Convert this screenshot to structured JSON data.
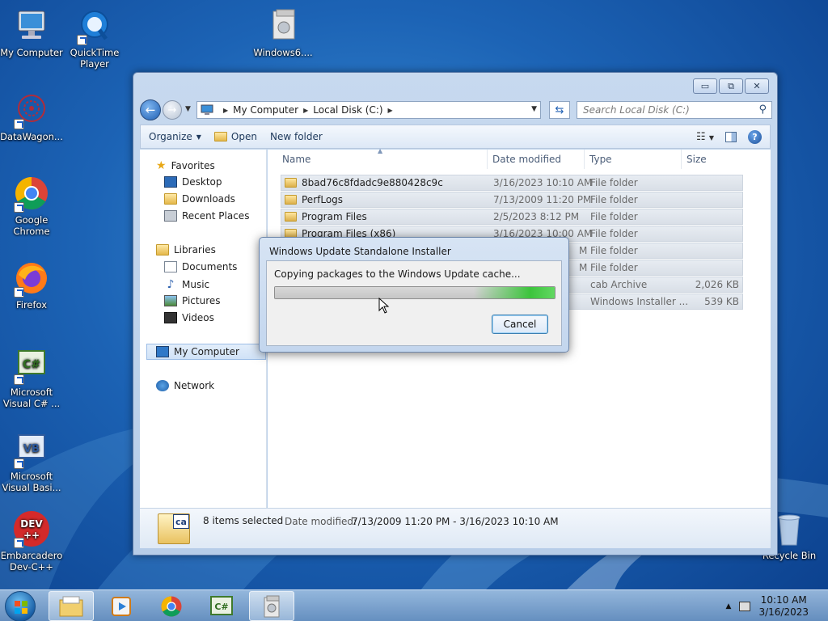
{
  "desktop": {
    "icons": [
      {
        "label": "My Computer"
      },
      {
        "label": "QuickTime Player"
      },
      {
        "label": "Windows6...."
      },
      {
        "label": "DataWagon..."
      },
      {
        "label": "Google Chrome"
      },
      {
        "label": "Firefox"
      },
      {
        "label": "Microsoft Visual C# ..."
      },
      {
        "label": "Microsoft Visual Basi..."
      },
      {
        "label": "Embarcadero Dev-C++"
      },
      {
        "label": "Recycle Bin"
      }
    ]
  },
  "explorer": {
    "breadcrumb": [
      "My Computer",
      "Local Disk (C:)"
    ],
    "search_placeholder": "Search Local Disk (C:)",
    "toolbar": {
      "organize": "Organize",
      "open": "Open",
      "new_folder": "New folder"
    },
    "nav": {
      "favorites": "Favorites",
      "desktop": "Desktop",
      "downloads": "Downloads",
      "recent": "Recent Places",
      "libraries": "Libraries",
      "documents": "Documents",
      "music": "Music",
      "pictures": "Pictures",
      "videos": "Videos",
      "my_computer": "My Computer",
      "network": "Network"
    },
    "columns": {
      "name": "Name",
      "date": "Date modified",
      "type": "Type",
      "size": "Size"
    },
    "files": [
      {
        "name": "8bad76c8fdadc9e880428c9c",
        "date": "3/16/2023 10:10 AM",
        "type": "File folder",
        "size": ""
      },
      {
        "name": "PerfLogs",
        "date": "7/13/2009 11:20 PM",
        "type": "File folder",
        "size": ""
      },
      {
        "name": "Program Files",
        "date": "2/5/2023 8:12 PM",
        "type": "File folder",
        "size": ""
      },
      {
        "name": "Program Files (x86)",
        "date": "3/16/2023 10:00 AM",
        "type": "File folder",
        "size": ""
      },
      {
        "name": "",
        "date": "M",
        "type": "File folder",
        "size": ""
      },
      {
        "name": "",
        "date": "M",
        "type": "File folder",
        "size": ""
      },
      {
        "name": "",
        "date": "",
        "type": "cab Archive",
        "size": "2,026 KB"
      },
      {
        "name": "",
        "date": "",
        "type": "Windows Installer ...",
        "size": "539 KB"
      }
    ],
    "details": {
      "selected": "8 items selected",
      "date_label": "Date modified:",
      "date_value": "7/13/2009 11:20 PM - 3/16/2023 10:10 AM",
      "icon_text": "ca"
    }
  },
  "dialog": {
    "title": "Windows Update Standalone Installer",
    "message": "Copying packages to the Windows Update cache...",
    "progress": 1.0,
    "cancel": "Cancel"
  },
  "taskbar": {
    "time": "10:10 AM",
    "date": "3/16/2023"
  },
  "colors": {
    "wallpaper": "#1c63b5",
    "progress_green": "#3cc43c",
    "selection_row": "#d9dfe7"
  }
}
